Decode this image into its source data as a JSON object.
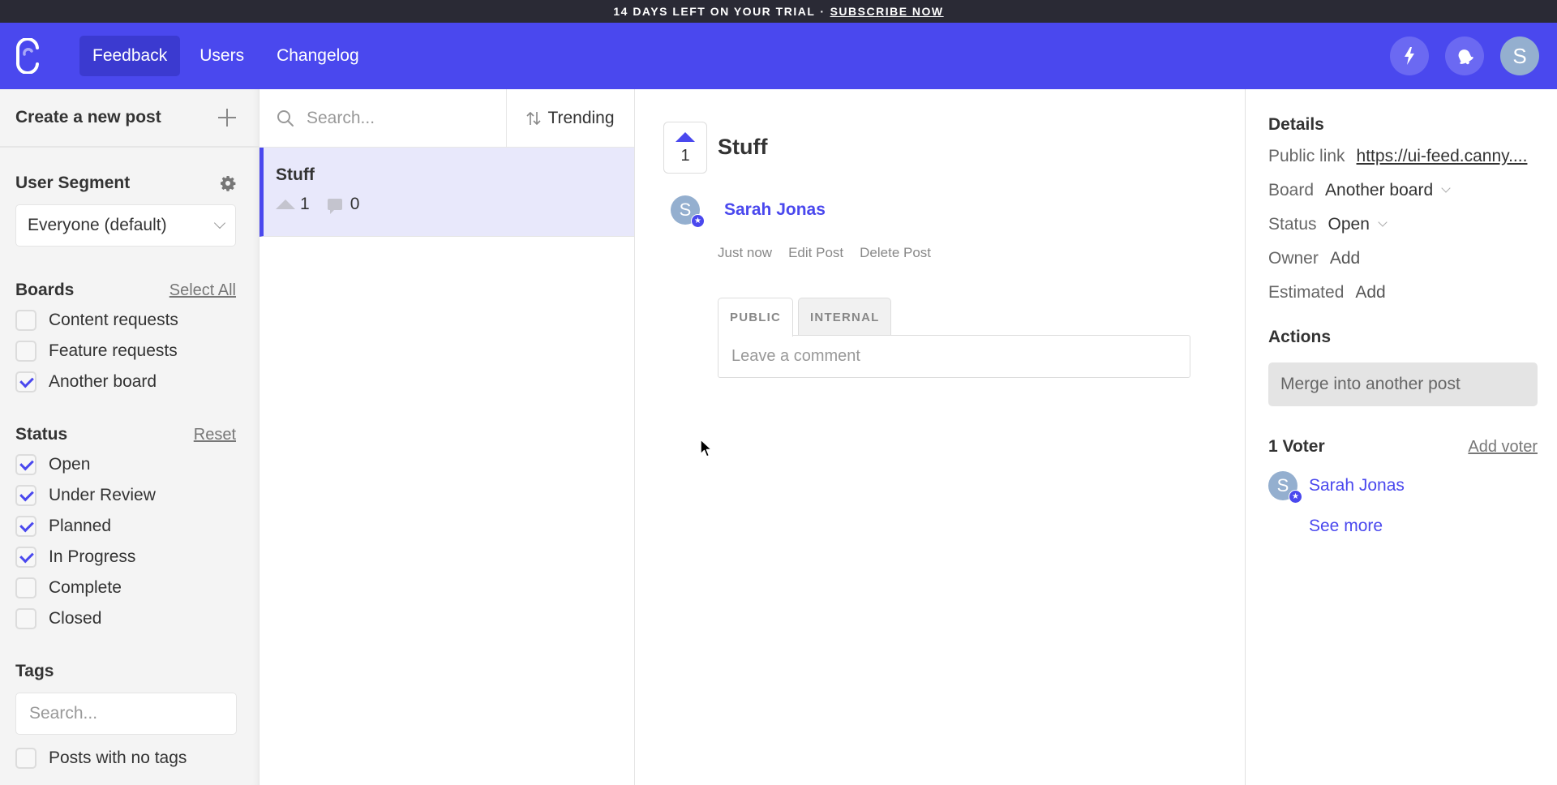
{
  "banner": {
    "text": "14 DAYS LEFT ON YOUR TRIAL",
    "separator": "·",
    "link": "SUBSCRIBE NOW"
  },
  "header": {
    "nav": [
      {
        "label": "Feedback",
        "active": true
      },
      {
        "label": "Users",
        "active": false
      },
      {
        "label": "Changelog",
        "active": false
      }
    ],
    "avatar_initial": "S",
    "icons": [
      "lightning-icon",
      "bell-icon"
    ]
  },
  "sidebar": {
    "create_post": "Create a new post",
    "user_segment": {
      "title": "User Segment",
      "selected": "Everyone (default)"
    },
    "boards": {
      "title": "Boards",
      "action": "Select All",
      "items": [
        {
          "label": "Content requests",
          "checked": false
        },
        {
          "label": "Feature requests",
          "checked": false
        },
        {
          "label": "Another board",
          "checked": true
        }
      ]
    },
    "status": {
      "title": "Status",
      "action": "Reset",
      "items": [
        {
          "label": "Open",
          "checked": true
        },
        {
          "label": "Under Review",
          "checked": true
        },
        {
          "label": "Planned",
          "checked": true
        },
        {
          "label": "In Progress",
          "checked": true
        },
        {
          "label": "Complete",
          "checked": false
        },
        {
          "label": "Closed",
          "checked": false
        }
      ]
    },
    "tags": {
      "title": "Tags",
      "placeholder": "Search...",
      "no_tags_label": "Posts with no tags",
      "no_tags_checked": false
    }
  },
  "postlist": {
    "search_placeholder": "Search...",
    "sort_label": "Trending",
    "posts": [
      {
        "title": "Stuff",
        "votes": "1",
        "comments": "0"
      }
    ]
  },
  "post": {
    "votes": "1",
    "title": "Stuff",
    "author": "Sarah Jonas",
    "author_initial": "S",
    "time": "Just now",
    "edit_label": "Edit Post",
    "delete_label": "Delete Post",
    "tabs": [
      "PUBLIC",
      "INTERNAL"
    ],
    "comment_placeholder": "Leave a comment"
  },
  "details": {
    "title": "Details",
    "public_link_label": "Public link",
    "public_link": "https://ui-feed.canny....",
    "board_label": "Board",
    "board_value": "Another board",
    "status_label": "Status",
    "status_value": "Open",
    "owner_label": "Owner",
    "owner_value": "Add",
    "estimated_label": "Estimated",
    "estimated_value": "Add",
    "actions_title": "Actions",
    "merge_label": "Merge into another post",
    "voters_title": "1 Voter",
    "add_voter": "Add voter",
    "voters": [
      {
        "name": "Sarah Jonas",
        "initial": "S"
      }
    ],
    "see_more": "See more"
  },
  "colors": {
    "accent": "#4a48ee",
    "banner_bg": "#2a2a35",
    "selected_post_bg": "#e8e8fb",
    "avatar_bg": "#94afcf"
  }
}
